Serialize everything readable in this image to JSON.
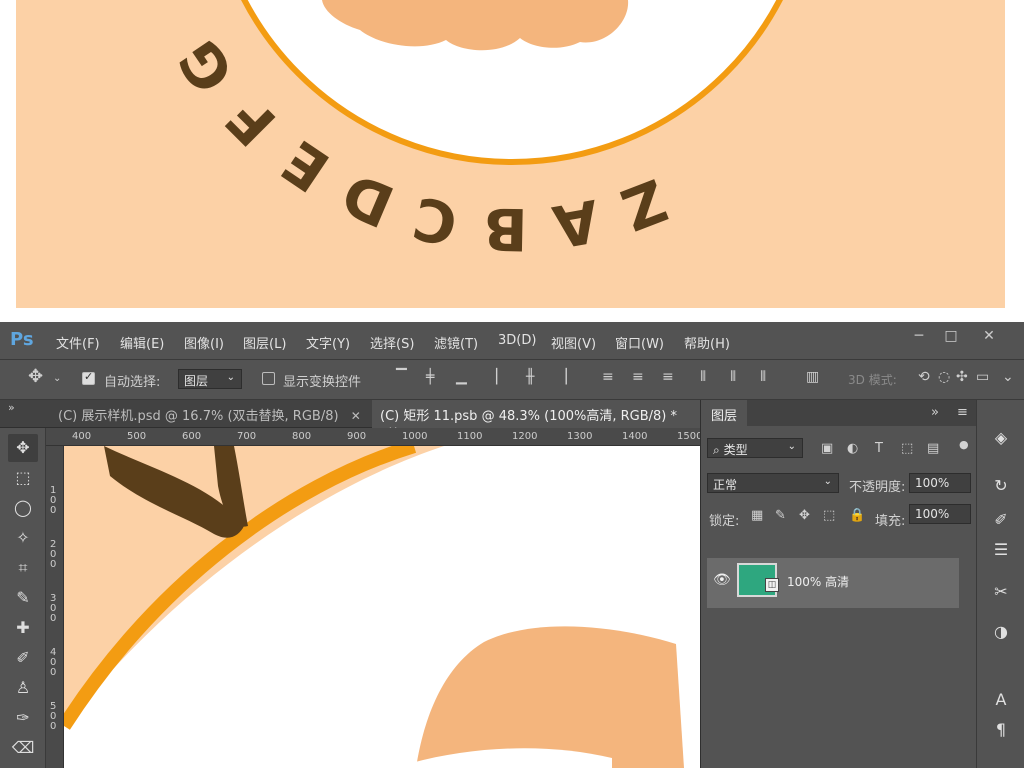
{
  "preview": {
    "ring_letters": [
      "G",
      "F",
      "E",
      "D",
      "C",
      "B",
      "A",
      "Z"
    ]
  },
  "app": {
    "logo": "Ps",
    "menu": [
      "文件(F)",
      "编辑(E)",
      "图像(I)",
      "图层(L)",
      "文字(Y)",
      "选择(S)",
      "滤镜(T)",
      "3D(D)",
      "视图(V)",
      "窗口(W)",
      "帮助(H)"
    ],
    "window_controls": [
      "─",
      "□",
      "✕"
    ]
  },
  "options": {
    "auto_select_label": "自动选择:",
    "auto_select_value": "图层",
    "show_transform_label": "显示变换控件",
    "mode_3d_label": "3D 模式:"
  },
  "tabs": {
    "doc1_label": "(C) 展示样机.psd @ 16.7% (双击替换, RGB/8)",
    "doc2_label": "(C) 矩形 11.psb @ 48.3% (100%高清, RGB/8) *"
  },
  "ruler": {
    "top_ticks": [
      "400",
      "500",
      "600",
      "700",
      "800",
      "900",
      "1000",
      "1100",
      "1200",
      "1300",
      "1400",
      "1500"
    ],
    "left_ticks": [
      "100",
      "200",
      "300",
      "400",
      "500"
    ]
  },
  "layers_panel": {
    "tab_label": "图层",
    "filter_label": "类型",
    "blend_mode": "正常",
    "opacity_label": "不透明度:",
    "opacity_value": "100%",
    "lock_label": "锁定:",
    "fill_label": "填充:",
    "fill_value": "100%",
    "layer_name": "100% 高清"
  },
  "colors": {
    "bg_peach": "#FCD1A6",
    "ring_orange": "#F39C12",
    "letter_brown": "#5A3E1A",
    "cookie": "#F4B57D",
    "layer_thumb": "#2EA77F"
  }
}
